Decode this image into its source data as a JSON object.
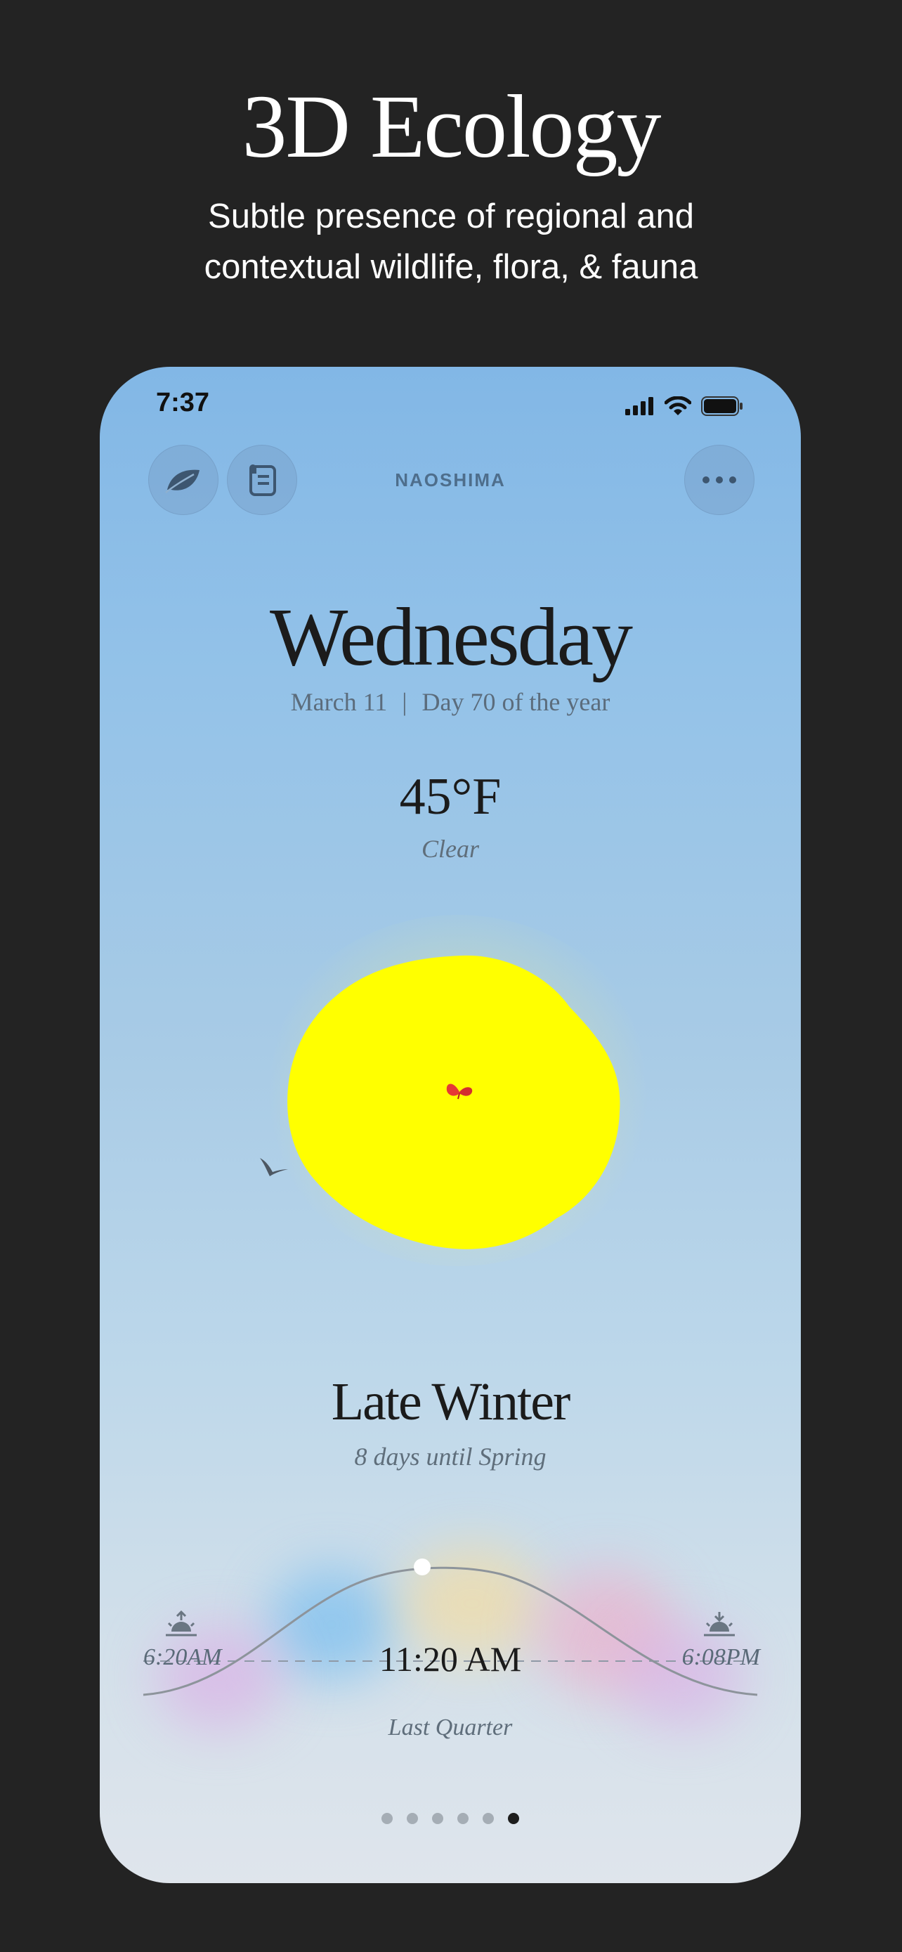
{
  "hero": {
    "title": "3D Ecology",
    "subtitle_line1": "Subtle presence of regional and",
    "subtitle_line2": "contextual wildlife, flora, & fauna"
  },
  "status_bar": {
    "time": "7:37",
    "icons": [
      "cellular-signal-icon",
      "wifi-icon",
      "battery-icon"
    ]
  },
  "header": {
    "location": "NAOSHIMA",
    "left_buttons": [
      "leaf-icon",
      "scroll-icon"
    ],
    "right_button": "more-icon"
  },
  "day": {
    "weekday": "Wednesday",
    "date": "March 11",
    "separator": "|",
    "day_of_year": "Day 70 of the year"
  },
  "weather": {
    "temperature": "45°F",
    "condition": "Clear"
  },
  "season": {
    "name": "Late Winter",
    "countdown": "8 days until Spring"
  },
  "sun_arc": {
    "sunrise": "6:20AM",
    "sunset": "6:08PM",
    "current_time": "11:20 AM",
    "moon_phase": "Last Quarter"
  },
  "pager": {
    "total": 6,
    "active_index": 5
  },
  "colors": {
    "sun": "#ffff00",
    "butterfly": "#e53935",
    "background": "#232323"
  }
}
